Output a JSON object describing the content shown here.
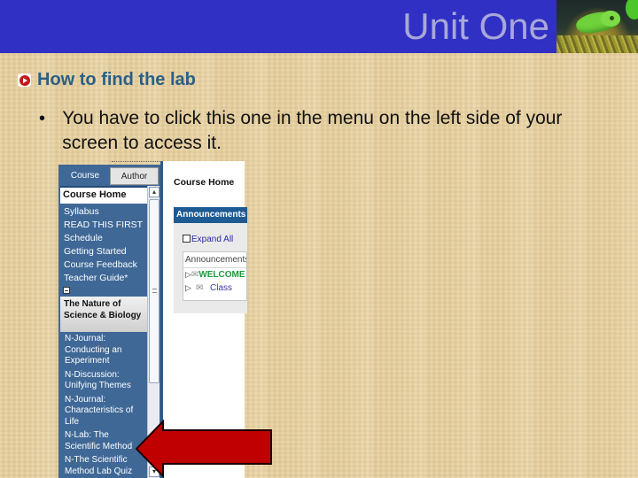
{
  "slide": {
    "title": "Unit One",
    "title_bar_color": "#3030c4",
    "photo_icon": "chameleon-photo",
    "heading": "How to find the lab",
    "heading_color": "#2b5f86",
    "bullet_glyph": "•",
    "bullet_text": "You have to click this one in the menu on the left side of your screen to access it."
  },
  "screenshot": {
    "tabs": [
      {
        "label": "Course",
        "active": true
      },
      {
        "label": "Author",
        "active": false
      }
    ],
    "menu": {
      "home": "Course Home",
      "items": [
        "Syllabus",
        "READ THIS FIRST",
        "Schedule",
        "Getting Started",
        "Course Feedback",
        "Teacher Guide*"
      ],
      "section": "The Nature of Science & Biology",
      "section_items": [
        "N-Journal: Conducting an Experiment",
        "N-Discussion: Unifying Themes",
        "N-Journal: Characteristics of Life",
        "N-Lab: The Scientific Method",
        "N-The Scientific Method Lab Quiz"
      ],
      "highlighted_item": "N-Lab: The Scientific Method"
    },
    "scrollbar": {
      "up": "▴",
      "down": "▾"
    },
    "right_pane": {
      "title": "Course Home",
      "announcements_header": "Announcements",
      "expand_all": "Expand All",
      "column_header": "Announcements",
      "rows": [
        {
          "arrow": "▷",
          "icon": "envelope-icon",
          "text": "WELCOME"
        },
        {
          "arrow": "▷",
          "icon": "envelope-icon",
          "text": "Class"
        }
      ]
    },
    "pointer_arrow_color": "#c00000"
  }
}
